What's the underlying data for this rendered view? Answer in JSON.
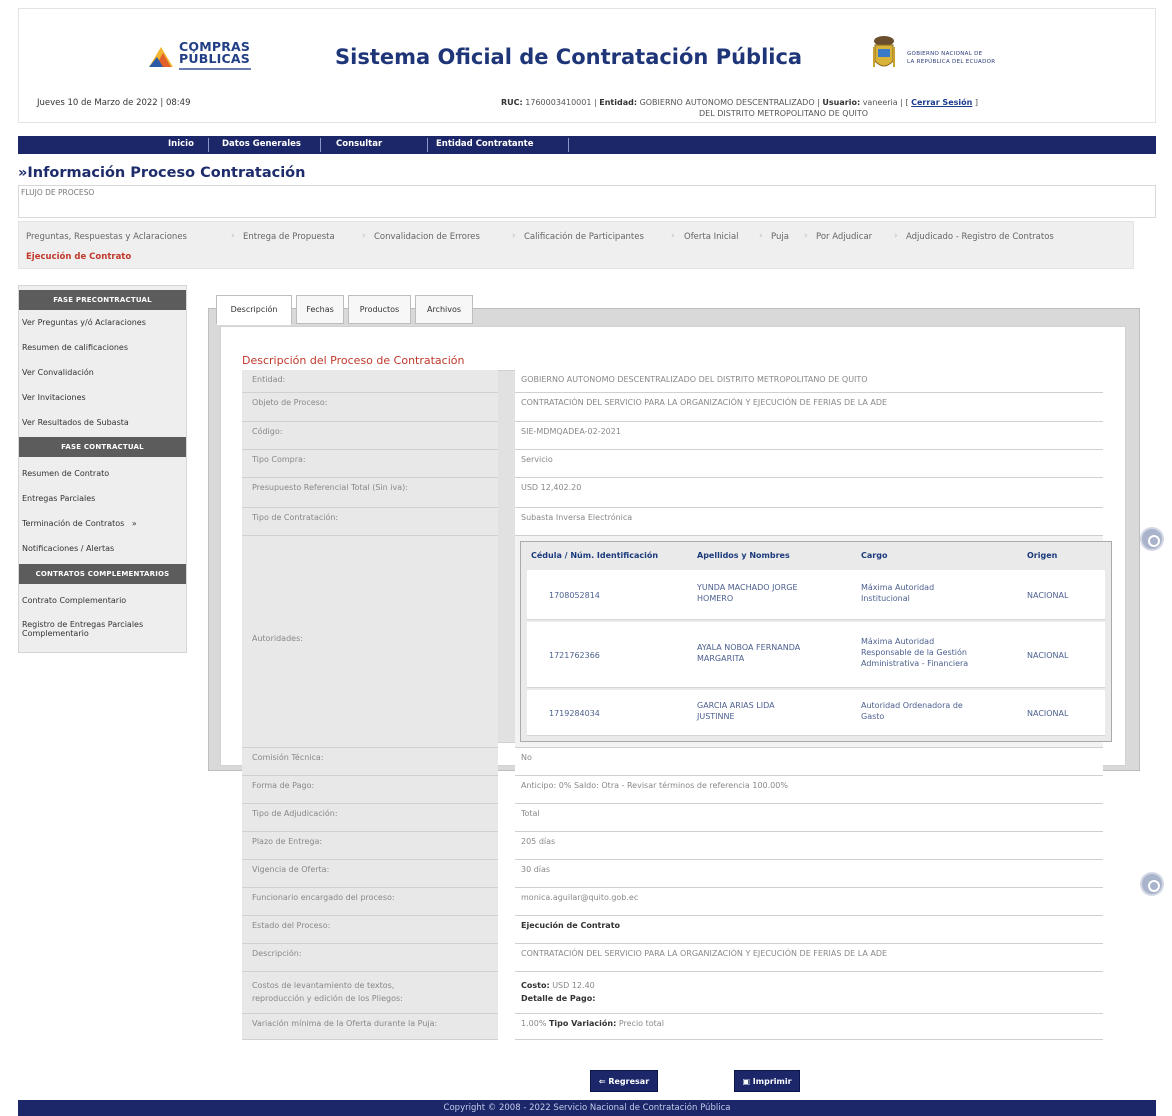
{
  "header": {
    "logo_line1": "COMPRAS",
    "logo_line2": "PÚBLICAS",
    "title": "Sistema Oficial de Contratación Pública",
    "gov_line1": "GOBIERNO NACIONAL DE",
    "gov_line2": "LA REPÚBLICA DEL ECUADOR",
    "date": "Jueves 10 de Marzo de 2022 | 08:49",
    "ruc_label": "RUC:",
    "ruc": "1760003410001",
    "entity_label": "Entidad:",
    "entity_line1": "GOBIERNO AUTONOMO DESCENTRALIZADO",
    "entity_line2": "DEL DISTRITO METROPOLITANO DE QUITO",
    "user_label": "Usuario:",
    "user": "vaneeria",
    "logout": "Cerrar Sesión"
  },
  "nav": [
    "Inicio",
    "Datos Generales",
    "Consultar",
    "Entidad Contratante"
  ],
  "section_title": "»Información Proceso Contratación",
  "flujo_label": "FLUJO DE PROCESO",
  "steps": [
    "Preguntas, Respuestas y Aclaraciones",
    "Entrega de Propuesta",
    "Convalidacion de Errores",
    "Calificación de Participantes",
    "Oferta Inicial",
    "Puja",
    "Por Adjudicar",
    "Adjudicado - Registro de Contratos",
    "Ejecución de Contrato"
  ],
  "sidebar": {
    "head1": "FASE PRECONTRACTUAL",
    "group1": [
      "Ver Preguntas y/ó Aclaraciones",
      "Resumen de calificaciones",
      "Ver Convalidación",
      "Ver Invitaciones",
      "Ver Resultados de Subasta"
    ],
    "head2": "FASE CONTRACTUAL",
    "group2": [
      "Resumen de Contrato",
      "Entregas Parciales",
      "Terminación de Contratos",
      "Notificaciones / Alertas"
    ],
    "head3": "CONTRATOS COMPLEMENTARIOS",
    "group3": [
      "Contrato Complementario",
      "Registro de Entregas Parciales",
      "Complementario"
    ]
  },
  "tabs": [
    "Descripción",
    "Fechas",
    "Productos",
    "Archivos"
  ],
  "desc_title": "Descripción del Proceso de Contratación",
  "fields": [
    {
      "label": "Entidad:",
      "value": "GOBIERNO AUTONOMO DESCENTRALIZADO DEL DISTRITO METROPOLITANO DE QUITO"
    },
    {
      "label": "Objeto de Proceso:",
      "value": "CONTRATACIÓN DEL SERVICIO PARA LA ORGANIZACIÓN Y EJECUCIÓN DE FERIAS DE LA ADE"
    },
    {
      "label": "Código:",
      "value": "SIE-MDMQADEA-02-2021"
    },
    {
      "label": "Tipo Compra:",
      "value": "Servicio"
    },
    {
      "label": "Presupuesto Referencial Total (Sin iva):",
      "value": "USD 12,402.20"
    },
    {
      "label": "Tipo de Contratación:",
      "value": "Subasta Inversa Electrónica"
    }
  ],
  "autoridades": {
    "label": "Autoridades:",
    "headers": [
      "Cédula / Núm. Identificación",
      "Apellidos y Nombres",
      "Cargo",
      "Origen"
    ],
    "rows": [
      {
        "id": "1708052814",
        "name1": "YUNDA MACHADO JORGE",
        "name2": "HOMERO",
        "cargo1": "Máxima Autoridad",
        "cargo2": "Institucional",
        "cargo3": "",
        "origen": "NACIONAL"
      },
      {
        "id": "1721762366",
        "name1": "AYALA NOBOA FERNANDA",
        "name2": "MARGARITA",
        "cargo1": "Máxima Autoridad",
        "cargo2": "Responsable de la Gestión",
        "cargo3": "Administrativa - Financiera",
        "origen": "NACIONAL"
      },
      {
        "id": "1719284034",
        "name1": "GARCIA ARIAS LIDA",
        "name2": "JUSTINNE",
        "cargo1": "Autoridad Ordenadora de",
        "cargo2": "Gasto",
        "cargo3": "",
        "origen": "NACIONAL"
      }
    ]
  },
  "fields2": [
    {
      "label": "Comisión Técnica:",
      "value": "No"
    },
    {
      "label": "Forma de Pago:",
      "value": "Anticipo: 0% Saldo: Otra - Revisar términos de referencia 100.00%"
    },
    {
      "label": "Tipo de Adjudicación:",
      "value": "Total"
    },
    {
      "label": "Plazo de Entrega:",
      "value": "205 días"
    },
    {
      "label": "Vigencia de Oferta:",
      "value": "30 días"
    },
    {
      "label": "Funcionario encargado del proceso:",
      "value": "monica.aguilar@quito.gob.ec"
    },
    {
      "label": "Estado del Proceso:",
      "value": "Ejecución de Contrato"
    },
    {
      "label": "Descripción:",
      "value": "CONTRATACIÓN DEL SERVICIO PARA LA ORGANIZACIÓN Y EJECUCIÓN DE FERIAS DE LA ADE"
    }
  ],
  "costos": {
    "label1": "Costos de levantamiento de textos,",
    "label2": "reproducción y edición de los Pliegos:",
    "costo_label": "Costo:",
    "costo": "USD 12.40",
    "detalle_label": "Detalle de Pago:"
  },
  "variacion": {
    "label": "Variación mínima de la Oferta durante la Puja:",
    "value": "1.00%",
    "tipo_label": "Tipo Variación:",
    "tipo": "Precio total"
  },
  "buttons": {
    "back": "Regresar",
    "print": "Imprimir"
  },
  "footer": "Copyright © 2008 - 2022 Servicio Nacional de Contratación Pública",
  "colors": {
    "navy": "#1c2769",
    "accent_red": "#c0392b"
  }
}
